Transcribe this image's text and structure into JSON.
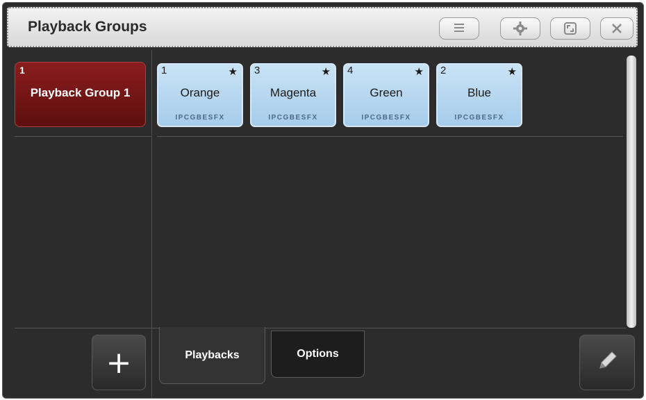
{
  "window": {
    "title": "Playback Groups"
  },
  "toolbar": {
    "menu_icon": "menu-icon",
    "settings_icon": "gear-icon",
    "fullscreen_icon": "fullscreen-icon",
    "close_icon": "close-icon"
  },
  "groups": [
    {
      "number": "1",
      "name": "Playback Group 1"
    }
  ],
  "playbacks": [
    {
      "number": "1",
      "name": "Orange",
      "attrs": "IPCGBESFX"
    },
    {
      "number": "3",
      "name": "Magenta",
      "attrs": "IPCGBESFX"
    },
    {
      "number": "4",
      "name": "Green",
      "attrs": "IPCGBESFX"
    },
    {
      "number": "2",
      "name": "Blue",
      "attrs": "IPCGBESFX"
    }
  ],
  "star": "★",
  "add_label": "+",
  "tabs": {
    "playbacks": "Playbacks",
    "options": "Options"
  },
  "colors": {
    "group_tile": "#7a1818",
    "playback_tile": "#b8d9f0",
    "background": "#2c2c2c"
  }
}
